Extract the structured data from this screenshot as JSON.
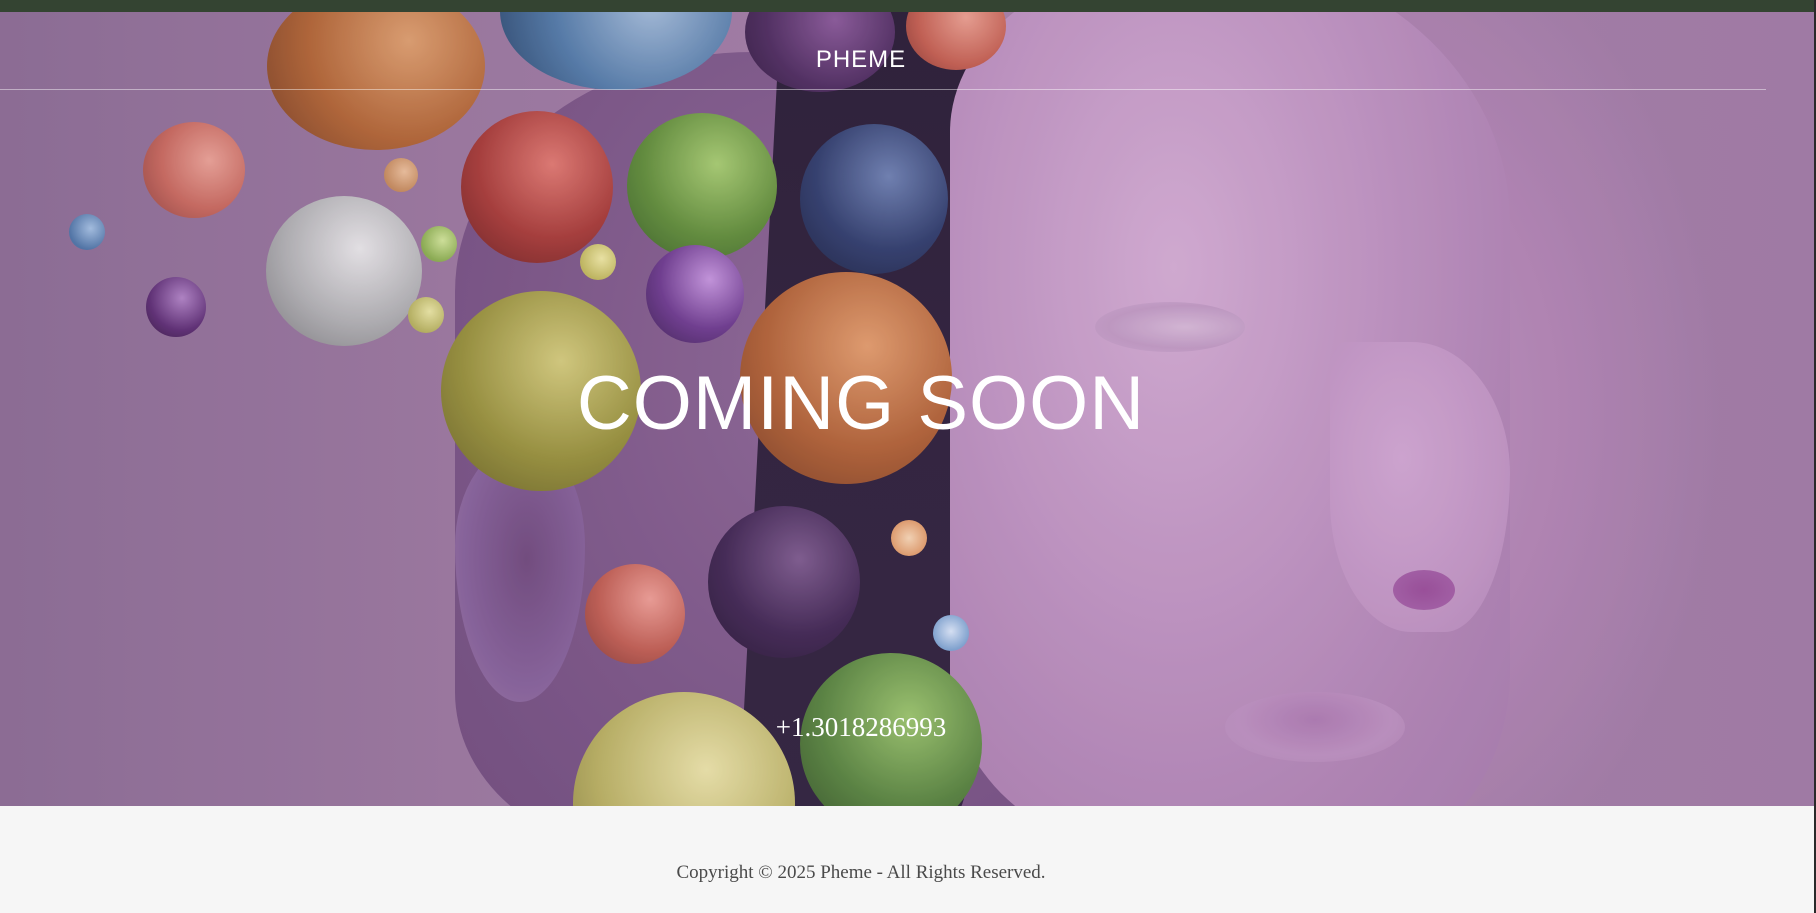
{
  "header": {
    "site_title": "PHEME"
  },
  "hero": {
    "headline": "COMING SOON",
    "phone": "+1.3018286993",
    "background_image": "head-with-colorful-spheres"
  },
  "footer": {
    "copyright": "Copyright © 2025 Pheme - All Rights Reserved."
  },
  "colors": {
    "top_bar": "#344432",
    "hero_tint": "#a27ea7",
    "footer_background": "#f6f6f6",
    "footer_text": "#4a4a4a",
    "hero_text": "#ffffff"
  }
}
